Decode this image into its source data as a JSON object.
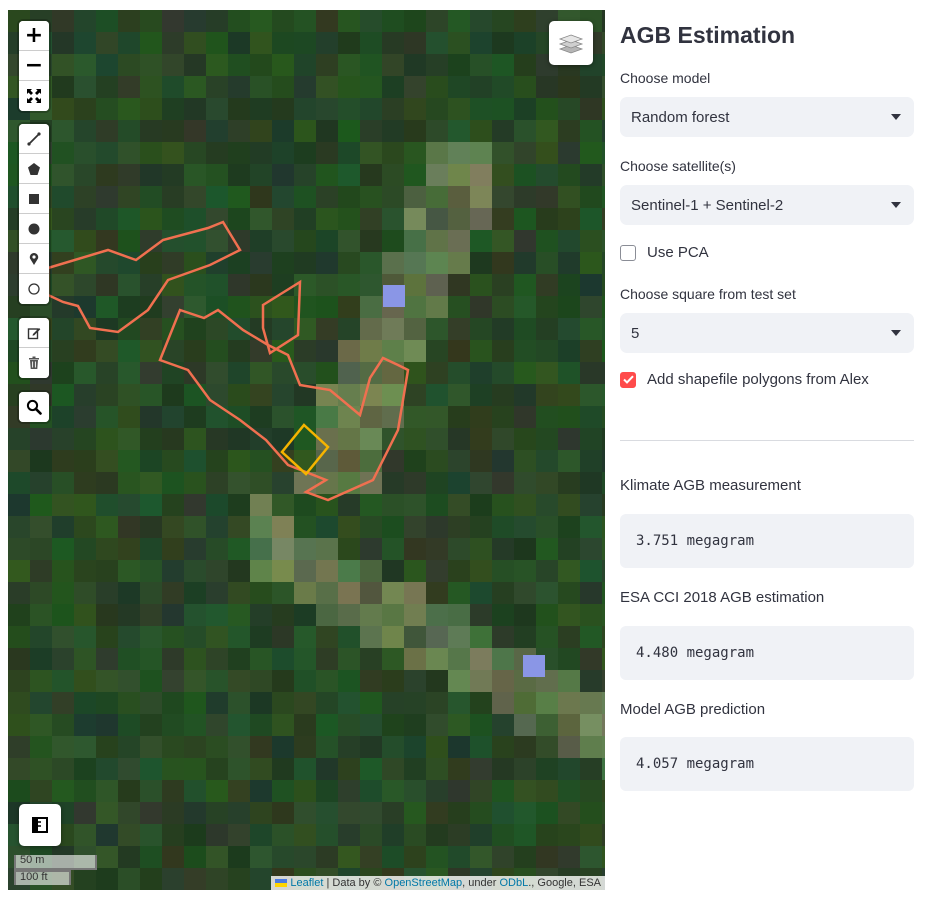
{
  "map": {
    "zoom_in": "+",
    "zoom_out": "−",
    "scale_metric": "50 m",
    "scale_imperial": "100 ft",
    "attribution": {
      "leaflet": "Leaflet",
      "data_by": " | Data by © ",
      "osm": "OpenStreetMap",
      "under": ", under ",
      "odbl": "ODbL",
      "rest": "., Google, ESA"
    },
    "colors": {
      "polygon": "#f07050",
      "square": "#f5b400"
    }
  },
  "panel": {
    "title": "AGB Estimation",
    "model_label": "Choose model",
    "model_value": "Random forest",
    "satellite_label": "Choose satellite(s)",
    "satellite_value": "Sentinel-1 + Sentinel-2",
    "pca_label": "Use PCA",
    "pca_checked": false,
    "square_label": "Choose square from test set",
    "square_value": "5",
    "shapefile_label": "Add shapefile polygons from Alex",
    "shapefile_checked": true,
    "accent_color": "#ff4b4b"
  },
  "results": {
    "klimate_label": "Klimate AGB measurement",
    "klimate_value": "3.751 megagram",
    "esa_label": "ESA CCI 2018 AGB estimation",
    "esa_value": "4.480 megagram",
    "model_label": "Model AGB prediction",
    "model_value": "4.057 megagram"
  }
}
